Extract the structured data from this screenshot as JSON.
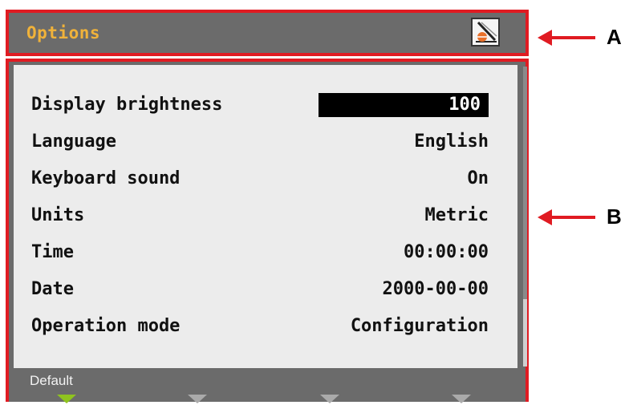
{
  "header": {
    "title": "Options",
    "icon": "pen-tool-icon"
  },
  "settings": [
    {
      "label": "Display brightness",
      "value": "100",
      "selected": true
    },
    {
      "label": "Language",
      "value": "English"
    },
    {
      "label": "Keyboard sound",
      "value": "On"
    },
    {
      "label": "Units",
      "value": "Metric"
    },
    {
      "label": "Time",
      "value": "00:00:00"
    },
    {
      "label": "Date",
      "value": "2000-00-00"
    },
    {
      "label": "Operation mode",
      "value": "Configuration"
    }
  ],
  "softkeys": [
    {
      "label": "Default",
      "active": true
    },
    {
      "label": "",
      "active": false
    },
    {
      "label": "",
      "active": false
    },
    {
      "label": "",
      "active": false
    }
  ],
  "annotations": {
    "a": "A",
    "b": "B"
  },
  "colors": {
    "highlight": "#e01b22",
    "title": "#f0b23a",
    "active_key": "#8fc31f"
  }
}
